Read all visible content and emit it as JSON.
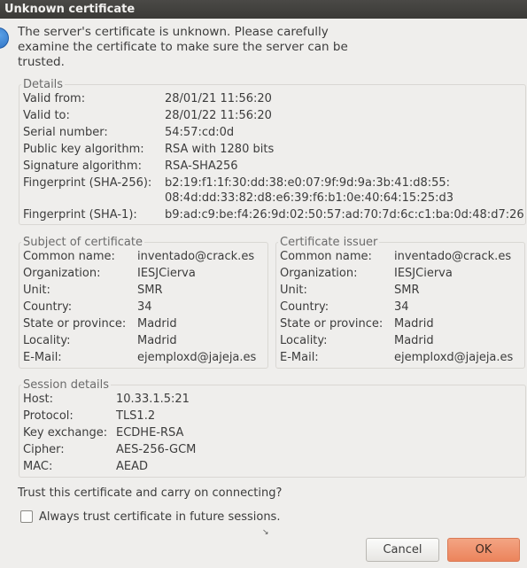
{
  "window": {
    "title": "Unknown certificate"
  },
  "intro": {
    "text": "The server's certificate is unknown. Please carefully examine the certificate to make sure the server can be trusted."
  },
  "details": {
    "legend": "Details",
    "valid_from_label": "Valid from:",
    "valid_from": "28/01/21 11:56:20",
    "valid_to_label": "Valid to:",
    "valid_to": "28/01/22 11:56:20",
    "serial_label": "Serial number:",
    "serial": "54:57:cd:0d",
    "pubkey_label": "Public key algorithm:",
    "pubkey": "RSA with 1280 bits",
    "sigalg_label": "Signature algorithm:",
    "sigalg": "RSA-SHA256",
    "sha256_label": "Fingerprint (SHA-256):",
    "sha256_line1": "b2:19:f1:1f:30:dd:38:e0:07:9f:9d:9a:3b:41:d8:55:",
    "sha256_line2": "08:4d:dd:33:82:d8:e6:39:f6:b1:0e:40:64:15:25:d3",
    "sha1_label": "Fingerprint (SHA-1):",
    "sha1": "b9:ad:c9:be:f4:26:9d:02:50:57:ad:70:7d:6c:c1:ba:0d:48:d7:26"
  },
  "subject": {
    "legend": "Subject of certificate",
    "cn_label": "Common name:",
    "cn": "inventado@crack.es",
    "org_label": "Organization:",
    "org": "IESJCierva",
    "unit_label": "Unit:",
    "unit": "SMR",
    "country_label": "Country:",
    "country": "34",
    "state_label": "State or province:",
    "state": "Madrid",
    "locality_label": "Locality:",
    "locality": "Madrid",
    "email_label": "E-Mail:",
    "email": "ejemploxd@jajeja.es"
  },
  "issuer": {
    "legend": "Certificate issuer",
    "cn_label": "Common name:",
    "cn": "inventado@crack.es",
    "org_label": "Organization:",
    "org": "IESJCierva",
    "unit_label": "Unit:",
    "unit": "SMR",
    "country_label": "Country:",
    "country": "34",
    "state_label": "State or province:",
    "state": "Madrid",
    "locality_label": "Locality:",
    "locality": "Madrid",
    "email_label": "E-Mail:",
    "email": "ejemploxd@jajeja.es"
  },
  "session": {
    "legend": "Session details",
    "host_label": "Host:",
    "host": "10.33.1.5:21",
    "protocol_label": "Protocol:",
    "protocol": "TLS1.2",
    "kex_label": "Key exchange:",
    "kex": "ECDHE-RSA",
    "cipher_label": "Cipher:",
    "cipher": "AES-256-GCM",
    "mac_label": "MAC:",
    "mac": "AEAD"
  },
  "trust": {
    "question": "Trust this certificate and carry on connecting?",
    "always_label": "Always trust certificate in future sessions.",
    "always_checked": false
  },
  "buttons": {
    "cancel": "Cancel",
    "ok": "OK"
  },
  "colors": {
    "ok_button": "#ec845c",
    "titlebar": "#3b3a37"
  }
}
